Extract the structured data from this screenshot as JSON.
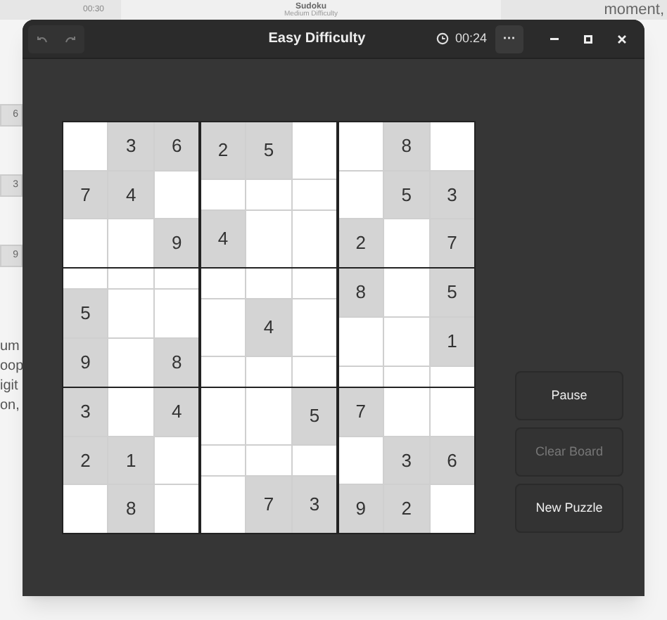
{
  "background": {
    "window_title": "Sudoku",
    "window_subtitle": "Medium Difficulty",
    "timer": "00:30",
    "corner_text": "moment,",
    "side_cells": [
      "6",
      "3",
      "9"
    ],
    "side_text": [
      "um",
      "oop",
      "igit",
      "on,"
    ]
  },
  "window": {
    "title": "Easy Difficulty",
    "timer": "00:24",
    "menu": "···"
  },
  "board": {
    "rows": [
      [
        null,
        "3",
        "6",
        "2",
        "5",
        null,
        null,
        "8",
        null
      ],
      [
        "7",
        "4",
        null,
        null,
        null,
        null,
        null,
        "5",
        "3"
      ],
      [
        null,
        null,
        "9",
        "4",
        null,
        null,
        "2",
        null,
        "7"
      ],
      [
        null,
        null,
        null,
        null,
        null,
        null,
        "8",
        null,
        "5"
      ],
      [
        "5",
        null,
        null,
        null,
        "4",
        null,
        null,
        null,
        "1"
      ],
      [
        "9",
        null,
        "8",
        null,
        null,
        null,
        null,
        null,
        null
      ],
      [
        "3",
        null,
        "4",
        null,
        null,
        "5",
        "7",
        null,
        null
      ],
      [
        "2",
        "1",
        null,
        null,
        null,
        null,
        null,
        "3",
        "6"
      ],
      [
        null,
        "8",
        null,
        null,
        "7",
        "3",
        "9",
        "2",
        null
      ]
    ]
  },
  "buttons": [
    {
      "label": "Pause",
      "disabled": false
    },
    {
      "label": "Clear Board",
      "disabled": true
    },
    {
      "label": "New Puzzle",
      "disabled": false
    }
  ]
}
